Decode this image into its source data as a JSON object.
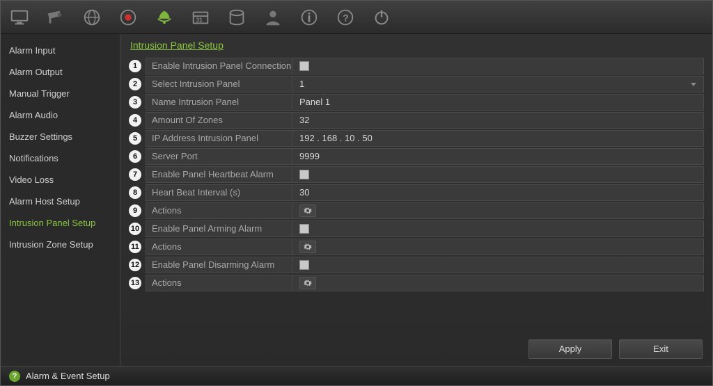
{
  "topbar_icons": [
    "monitor-icon",
    "camera-icon",
    "globe-icon",
    "record-icon",
    "alarm-icon",
    "schedule-icon",
    "storage-icon",
    "user-icon",
    "info-icon",
    "help-icon",
    "power-icon"
  ],
  "sidebar": {
    "items": [
      {
        "label": "Alarm Input"
      },
      {
        "label": "Alarm Output"
      },
      {
        "label": "Manual Trigger"
      },
      {
        "label": "Alarm Audio"
      },
      {
        "label": "Buzzer Settings"
      },
      {
        "label": "Notifications"
      },
      {
        "label": "Video Loss"
      },
      {
        "label": "Alarm Host Setup"
      },
      {
        "label": "Intrusion Panel Setup"
      },
      {
        "label": "Intrusion Zone Setup"
      }
    ],
    "selected_index": 8
  },
  "page": {
    "title": "Intrusion Panel Setup"
  },
  "fields": [
    {
      "n": "1",
      "label": "Enable Intrusion Panel Connection",
      "type": "checkbox",
      "value": false
    },
    {
      "n": "2",
      "label": "Select Intrusion Panel",
      "type": "select",
      "value": "1"
    },
    {
      "n": "3",
      "label": "Name Intrusion Panel",
      "type": "text",
      "value": "Panel 1"
    },
    {
      "n": "4",
      "label": "Amount Of Zones",
      "type": "text",
      "value": "32"
    },
    {
      "n": "5",
      "label": "IP Address Intrusion Panel",
      "type": "text",
      "value": "192 . 168 . 10   . 50"
    },
    {
      "n": "6",
      "label": "Server Port",
      "type": "text",
      "value": "9999"
    },
    {
      "n": "7",
      "label": "Enable Panel Heartbeat Alarm",
      "type": "checkbox",
      "value": false
    },
    {
      "n": "8",
      "label": "Heart Beat Interval (s)",
      "type": "text",
      "value": "30"
    },
    {
      "n": "9",
      "label": "Actions",
      "type": "gear"
    },
    {
      "n": "10",
      "label": "Enable Panel Arming Alarm",
      "type": "checkbox",
      "value": false
    },
    {
      "n": "11",
      "label": "Actions",
      "type": "gear"
    },
    {
      "n": "12",
      "label": "Enable Panel Disarming Alarm",
      "type": "checkbox",
      "value": false
    },
    {
      "n": "13",
      "label": "Actions",
      "type": "gear"
    }
  ],
  "buttons": {
    "apply": "Apply",
    "exit": "Exit"
  },
  "statusbar": {
    "text": "Alarm & Event Setup"
  }
}
